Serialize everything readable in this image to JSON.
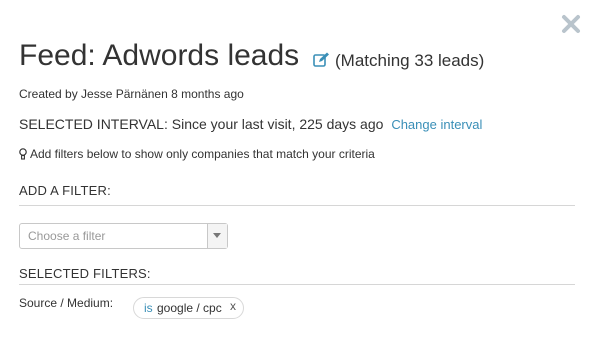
{
  "header": {
    "title": "Feed: Adwords leads",
    "matching": "(Matching 33 leads)",
    "created_by": "Created by Jesse Pärnänen 8 months ago"
  },
  "interval": {
    "text": "SELECTED INTERVAL: Since your last visit, 225 days ago",
    "change_link": "Change interval"
  },
  "hint": "Add filters below to show only companies that match your criteria",
  "add_filter": {
    "label": "ADD A FILTER:",
    "placeholder": "Choose a filter"
  },
  "selected_filters": {
    "label": "SELECTED FILTERS:",
    "items": [
      {
        "label": "Source / Medium:",
        "operator": "is",
        "value": "google / cpc",
        "remove": "x"
      }
    ]
  },
  "icons": [
    "close-icon",
    "edit-icon",
    "lightbulb-icon",
    "chevron-down-icon"
  ],
  "colors": {
    "link": "#3a8fb7",
    "close": "#b9c4cc",
    "text": "#333333"
  }
}
